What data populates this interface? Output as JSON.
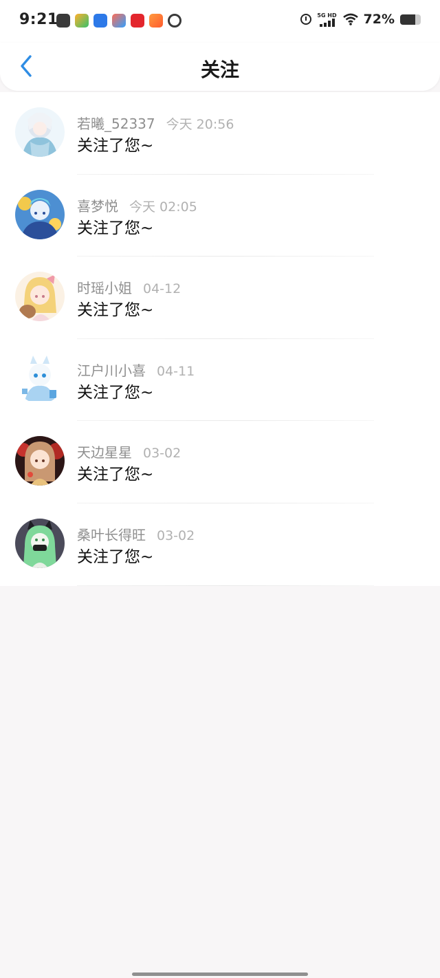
{
  "status_bar": {
    "time": "9:21",
    "network_label": "5G HD",
    "battery_percent": "72%",
    "battery_level": 0.72,
    "icons": [
      "alipay-icon",
      "video-app-icon",
      "app-store-icon",
      "browser-icon",
      "game-icon",
      "flower-icon",
      "search-app-icon",
      "alarm-icon",
      "signal-icon",
      "wifi-icon",
      "battery-icon"
    ]
  },
  "header": {
    "title": "关注",
    "back_icon": "chevron-left-icon"
  },
  "colors": {
    "accent": "#2f8de4",
    "title_text": "#1a1a1a",
    "name_text": "#8f8f8f",
    "time_text": "#b1b1b1",
    "background": "#f8f6f7"
  },
  "items": [
    {
      "name": "若曦_52337",
      "time": "今天 20:56",
      "message": "关注了您~"
    },
    {
      "name": "喜梦悦",
      "time": "今天 02:05",
      "message": "关注了您~"
    },
    {
      "name": "时瑶小姐",
      "time": "04-12",
      "message": "关注了您~"
    },
    {
      "name": "江户川小喜",
      "time": "04-11",
      "message": "关注了您~"
    },
    {
      "name": "天边星星",
      "time": "03-02",
      "message": "关注了您~"
    },
    {
      "name": "桑叶长得旺",
      "time": "03-02",
      "message": "关注了您~"
    }
  ]
}
